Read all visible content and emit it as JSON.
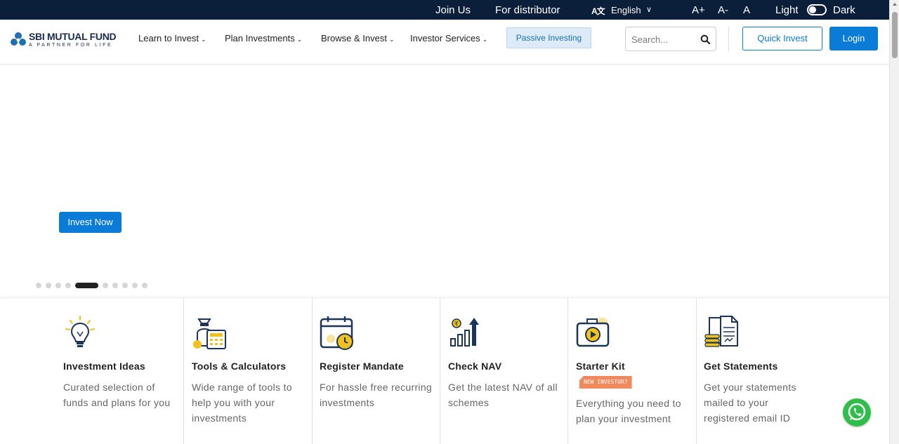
{
  "topbar": {
    "join_us": "Join Us",
    "for_distributor": "For distributor",
    "language_icon": "translate-icon",
    "language": "English",
    "font_increase": "A+",
    "font_decrease": "A-",
    "font_reset": "A",
    "theme_light": "Light",
    "theme_dark": "Dark"
  },
  "brand": {
    "name": "SBI MUTUAL FUND",
    "tagline": "A PARTNER FOR LIFE"
  },
  "nav": {
    "items": [
      {
        "label": "Learn to Invest"
      },
      {
        "label": "Plan Investments"
      },
      {
        "label": "Browse & Invest"
      },
      {
        "label": "Investor Services"
      }
    ],
    "passive": "Passive Investing",
    "search_placeholder": "Search...",
    "quick_invest": "Quick Invest",
    "login": "Login"
  },
  "hero": {
    "cta": "Invest Now",
    "slides_total": 10,
    "active_slide": 5
  },
  "features": [
    {
      "icon": "lightbulb-icon",
      "title": "Investment Ideas",
      "desc": "Curated selection of funds and plans for you"
    },
    {
      "icon": "calculator-icon",
      "title": "Tools & Calculators",
      "desc": "Wide range of tools to help you with your investments"
    },
    {
      "icon": "calendar-clock-icon",
      "title": "Register Mandate",
      "desc": "For hassle free recurring investments"
    },
    {
      "icon": "growth-chart-icon",
      "title": "Check NAV",
      "desc": "Get the latest NAV of all schemes"
    },
    {
      "icon": "video-tutorial-icon",
      "title": "Starter Kit",
      "badge": "NEW INVESTOR?",
      "desc": "Everything you need to plan your investment"
    },
    {
      "icon": "statement-document-icon",
      "title": "Get Statements",
      "desc": "Get your statements mailed to your registered email ID"
    }
  ],
  "colors": {
    "topbar_bg": "#0b1f3a",
    "primary": "#0a7bd6",
    "badge": "#f08a5d",
    "whatsapp": "#2fbe4a"
  }
}
